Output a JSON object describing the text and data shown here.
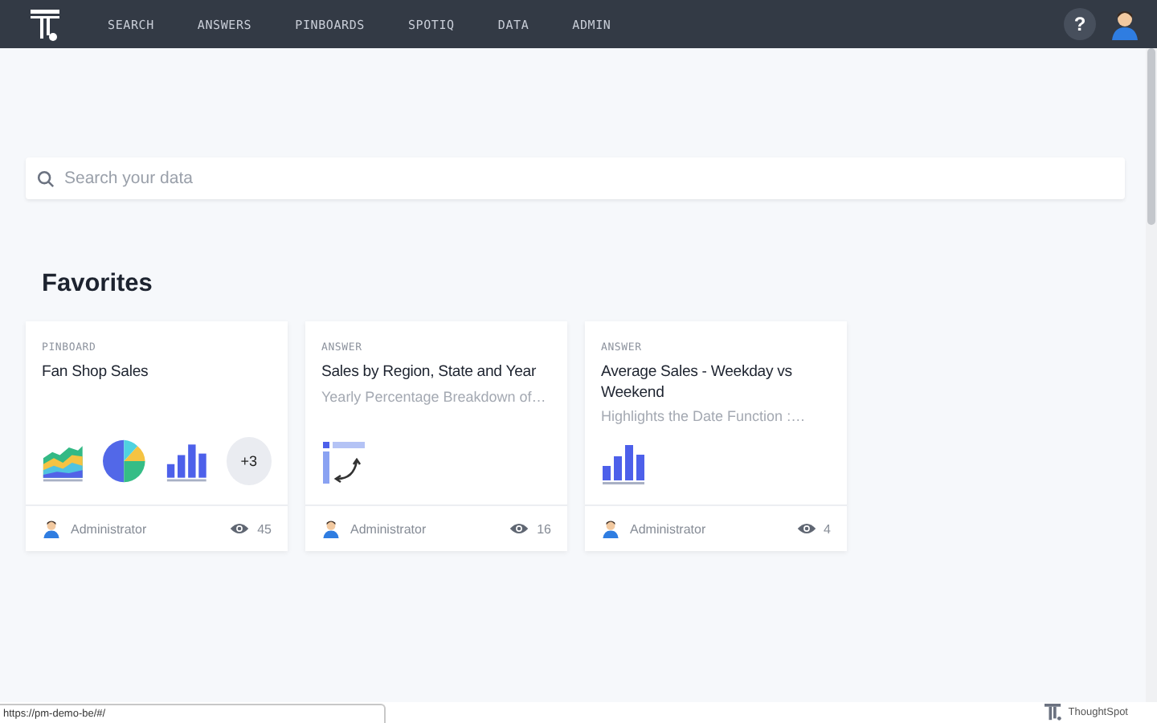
{
  "nav": {
    "items": [
      {
        "label": "SEARCH",
        "selected": false
      },
      {
        "label": "ANSWERS",
        "selected": false
      },
      {
        "label": "PINBOARDS",
        "selected": false
      },
      {
        "label": "SPOTIQ",
        "selected": false
      },
      {
        "label": "DATA",
        "selected": false
      },
      {
        "label": "ADMIN",
        "selected": false
      }
    ],
    "help": "?"
  },
  "search": {
    "placeholder": "Search your data"
  },
  "favorites": {
    "heading": "Favorites",
    "cards": [
      {
        "type": "PINBOARD",
        "title": "Fan Shop Sales",
        "thumbnails": [
          {
            "kind": "area"
          },
          {
            "kind": "pie"
          },
          {
            "kind": "bar"
          },
          {
            "kind": "more",
            "label": "+3"
          }
        ],
        "author": "Administrator",
        "views": "45"
      },
      {
        "type": "ANSWER",
        "title": "Sales by Region, State and Year",
        "subtitle": "Yearly Percentage Breakdown of…",
        "thumbnails": [
          {
            "kind": "pivot"
          }
        ],
        "author": "Administrator",
        "views": "16"
      },
      {
        "type": "ANSWER",
        "title": "Average Sales - Weekday vs Weekend",
        "subtitle": "Highlights the Date Function :…",
        "thumbnails": [
          {
            "kind": "bar"
          }
        ],
        "author": "Administrator",
        "views": "4"
      }
    ]
  },
  "status_url": "https://pm-demo-be/#/",
  "footer": {
    "brand": "ThoughtSpot"
  }
}
